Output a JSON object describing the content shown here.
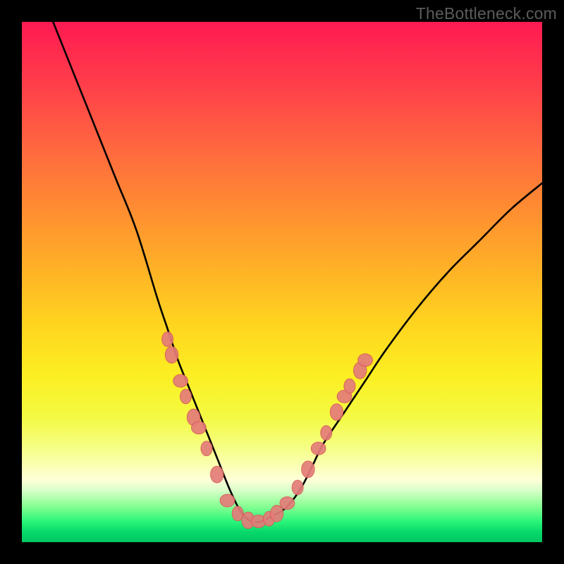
{
  "watermark": "TheBottleneck.com",
  "colors": {
    "frame": "#000000",
    "curve_stroke": "#000000",
    "marker_fill": "#e47c7a",
    "marker_stroke": "#d85c57"
  },
  "chart_data": {
    "type": "line",
    "title": "",
    "xlabel": "",
    "ylabel": "",
    "xlim": [
      0,
      100
    ],
    "ylim": [
      0,
      100
    ],
    "note": "Axes are unlabeled; values are pixel-proportional estimates read from the image. y=0 is bottom (green), y=100 is top (red). Curve is a V-shaped bottleneck profile with minimum near x≈44.",
    "series": [
      {
        "name": "bottleneck-curve",
        "x": [
          6,
          10,
          14,
          18,
          22,
          26,
          28,
          30,
          32,
          34,
          36,
          38,
          40,
          42,
          44,
          46,
          48,
          50,
          52,
          54,
          56,
          58,
          62,
          66,
          70,
          76,
          82,
          88,
          94,
          100
        ],
        "y": [
          100,
          90,
          80,
          70,
          60,
          47,
          41,
          35,
          30,
          25,
          20,
          15,
          10,
          6,
          4,
          4,
          5,
          6,
          8,
          11,
          15,
          19,
          25,
          31,
          37,
          45,
          52,
          58,
          64,
          69
        ]
      }
    ],
    "markers": {
      "name": "highlighted-points",
      "note": "Salmon blob markers clustered on both flanks of the V near the lower region.",
      "points": [
        {
          "x": 28.0,
          "y": 39
        },
        {
          "x": 28.8,
          "y": 36
        },
        {
          "x": 30.5,
          "y": 31
        },
        {
          "x": 31.5,
          "y": 28
        },
        {
          "x": 33.0,
          "y": 24
        },
        {
          "x": 34.0,
          "y": 22
        },
        {
          "x": 35.5,
          "y": 18
        },
        {
          "x": 37.5,
          "y": 13
        },
        {
          "x": 39.5,
          "y": 8
        },
        {
          "x": 41.5,
          "y": 5.5
        },
        {
          "x": 43.5,
          "y": 4.2
        },
        {
          "x": 45.5,
          "y": 4.0
        },
        {
          "x": 47.5,
          "y": 4.5
        },
        {
          "x": 49.0,
          "y": 5.5
        },
        {
          "x": 51.0,
          "y": 7.5
        },
        {
          "x": 53.0,
          "y": 10.5
        },
        {
          "x": 55.0,
          "y": 14
        },
        {
          "x": 57.0,
          "y": 18
        },
        {
          "x": 58.5,
          "y": 21
        },
        {
          "x": 60.5,
          "y": 25
        },
        {
          "x": 62.0,
          "y": 28
        },
        {
          "x": 63.0,
          "y": 30
        },
        {
          "x": 65.0,
          "y": 33
        },
        {
          "x": 66.0,
          "y": 35
        }
      ]
    }
  }
}
